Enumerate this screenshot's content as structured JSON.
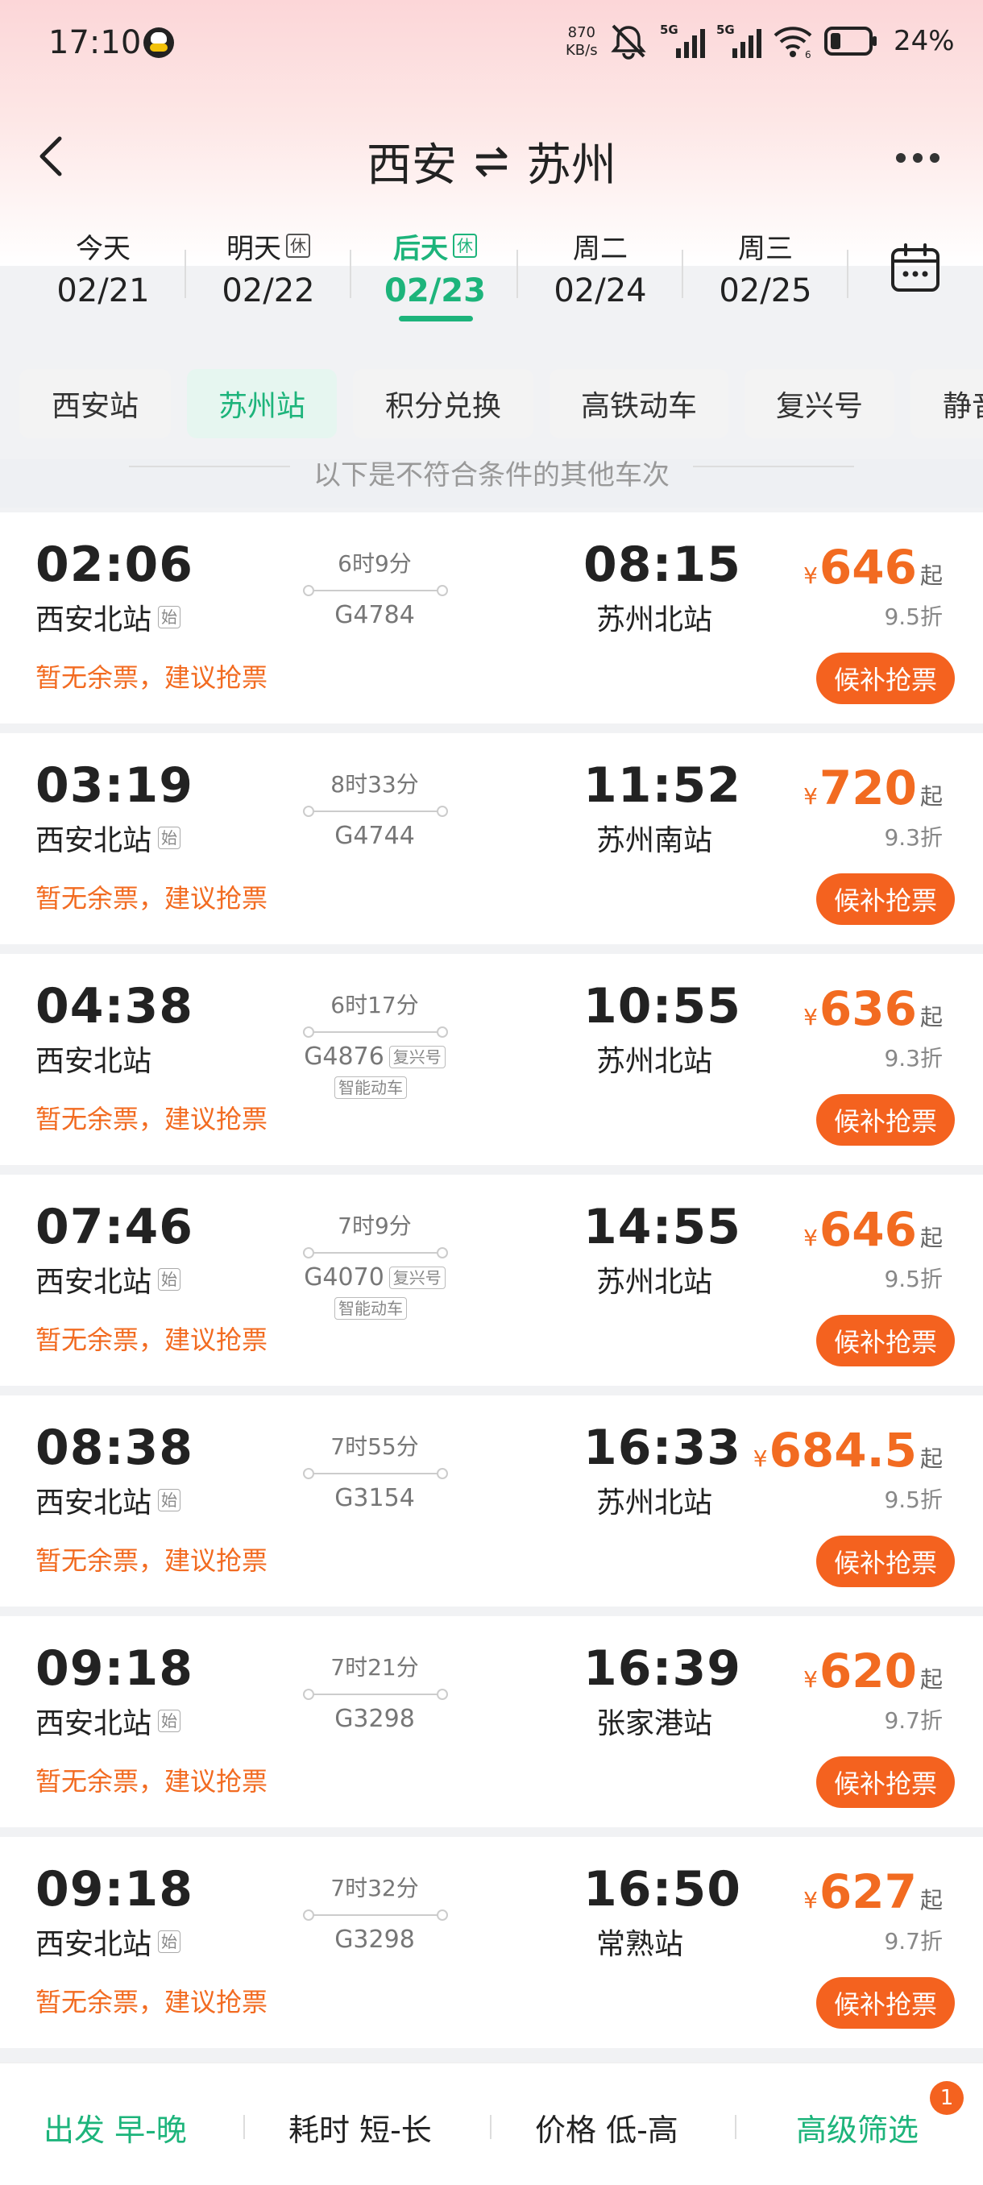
{
  "status": {
    "time": "17:10",
    "speed_value": "870",
    "speed_unit": "KB/s",
    "battery": "24%",
    "signal1": "5G",
    "signal2": "5G",
    "wifi_num": "6"
  },
  "nav": {
    "from": "西安",
    "to": "苏州"
  },
  "dates": [
    {
      "day": "今天",
      "date": "02/21",
      "rest": ""
    },
    {
      "day": "明天",
      "date": "02/22",
      "rest": "休"
    },
    {
      "day": "后天",
      "date": "02/23",
      "rest": "休",
      "active": true
    },
    {
      "day": "周二",
      "date": "02/24",
      "rest": ""
    },
    {
      "day": "周三",
      "date": "02/25",
      "rest": ""
    }
  ],
  "filters": [
    "西安站",
    "苏州站",
    "积分兑换",
    "高铁动车",
    "复兴号",
    "静音"
  ],
  "divider_text": "以下是不符合条件的其他车次",
  "trains": [
    {
      "dep": "02:06",
      "dep_station": "西安北站",
      "start_tag": "始",
      "duration": "6时9分",
      "train": "G4784",
      "tag": "",
      "tag2": "",
      "arr": "08:15",
      "arr_station": "苏州北站",
      "price": "646",
      "discount": "9.5折",
      "status": "暂无余票，建议抢票",
      "button": "候补抢票"
    },
    {
      "dep": "03:19",
      "dep_station": "西安北站",
      "start_tag": "始",
      "duration": "8时33分",
      "train": "G4744",
      "tag": "",
      "tag2": "",
      "arr": "11:52",
      "arr_station": "苏州南站",
      "price": "720",
      "discount": "9.3折",
      "status": "暂无余票，建议抢票",
      "button": "候补抢票"
    },
    {
      "dep": "04:38",
      "dep_station": "西安北站",
      "start_tag": "",
      "duration": "6时17分",
      "train": "G4876",
      "tag": "复兴号",
      "tag2": "智能动车",
      "arr": "10:55",
      "arr_station": "苏州北站",
      "price": "636",
      "discount": "9.3折",
      "status": "暂无余票，建议抢票",
      "button": "候补抢票"
    },
    {
      "dep": "07:46",
      "dep_station": "西安北站",
      "start_tag": "始",
      "duration": "7时9分",
      "train": "G4070",
      "tag": "复兴号",
      "tag2": "智能动车",
      "arr": "14:55",
      "arr_station": "苏州北站",
      "price": "646",
      "discount": "9.5折",
      "status": "暂无余票，建议抢票",
      "button": "候补抢票"
    },
    {
      "dep": "08:38",
      "dep_station": "西安北站",
      "start_tag": "始",
      "duration": "7时55分",
      "train": "G3154",
      "tag": "",
      "tag2": "",
      "arr": "16:33",
      "arr_station": "苏州北站",
      "price": "684.5",
      "discount": "9.5折",
      "status": "暂无余票，建议抢票",
      "button": "候补抢票"
    },
    {
      "dep": "09:18",
      "dep_station": "西安北站",
      "start_tag": "始",
      "duration": "7时21分",
      "train": "G3298",
      "tag": "",
      "tag2": "",
      "arr": "16:39",
      "arr_station": "张家港站",
      "price": "620",
      "discount": "9.7折",
      "status": "暂无余票，建议抢票",
      "button": "候补抢票"
    },
    {
      "dep": "09:18",
      "dep_station": "西安北站",
      "start_tag": "始",
      "duration": "7时32分",
      "train": "G3298",
      "tag": "",
      "tag2": "",
      "arr": "16:50",
      "arr_station": "常熟站",
      "price": "627",
      "discount": "9.7折",
      "status": "暂无余票，建议抢票",
      "button": "候补抢票"
    }
  ],
  "price_currency": "¥",
  "price_suffix": "起",
  "bottom": {
    "depart": "出发 早-晚",
    "duration": "耗时 短-长",
    "price": "价格 低-高",
    "advanced": "高级筛选",
    "badge": "1"
  },
  "colors": {
    "accent": "#1db47b",
    "orange": "#f26b21",
    "button": "#f4621f"
  }
}
